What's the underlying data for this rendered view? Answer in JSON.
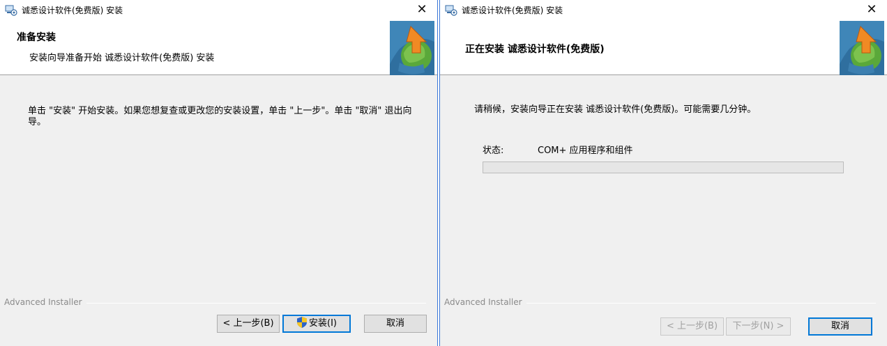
{
  "windows": {
    "left": {
      "title": "诚悉设计软件(免费版) 安装",
      "banner_title": "准备安装",
      "banner_subtitle": "安装向导准备开始 诚悉设计软件(免费版) 安装",
      "body_text": "单击 \"安装\" 开始安装。如果您想复查或更改您的安装设置，单击 \"上一步\"。单击 \"取消\" 退出向导。",
      "brand": "Advanced Installer",
      "buttons": {
        "back": "< 上一步(B)",
        "install": "安装(I)",
        "cancel": "取消"
      }
    },
    "right": {
      "title": "诚悉设计软件(免费版) 安装",
      "banner_title": "正在安装 诚悉设计软件(免费版)",
      "body_text": "请稍候，安装向导正在安装 诚悉设计软件(免费版)。可能需要几分钟。",
      "status_label": "状态:",
      "status_value": "COM+ 应用程序和组件",
      "progress_fraction": 0,
      "brand": "Advanced Installer",
      "buttons": {
        "back": "< 上一步(B)",
        "next": "下一步(N) >",
        "cancel": "取消"
      }
    }
  },
  "icons": {
    "app": "installer-app-icon",
    "logo": "installer-puzzle-logo",
    "close": "close-icon",
    "shield": "uac-shield-icon"
  },
  "colors": {
    "window_background": "#f0f0f0",
    "active_border": "#3b78d8",
    "default_button_border": "#0078d7",
    "disabled_text": "#a0a0a0"
  }
}
